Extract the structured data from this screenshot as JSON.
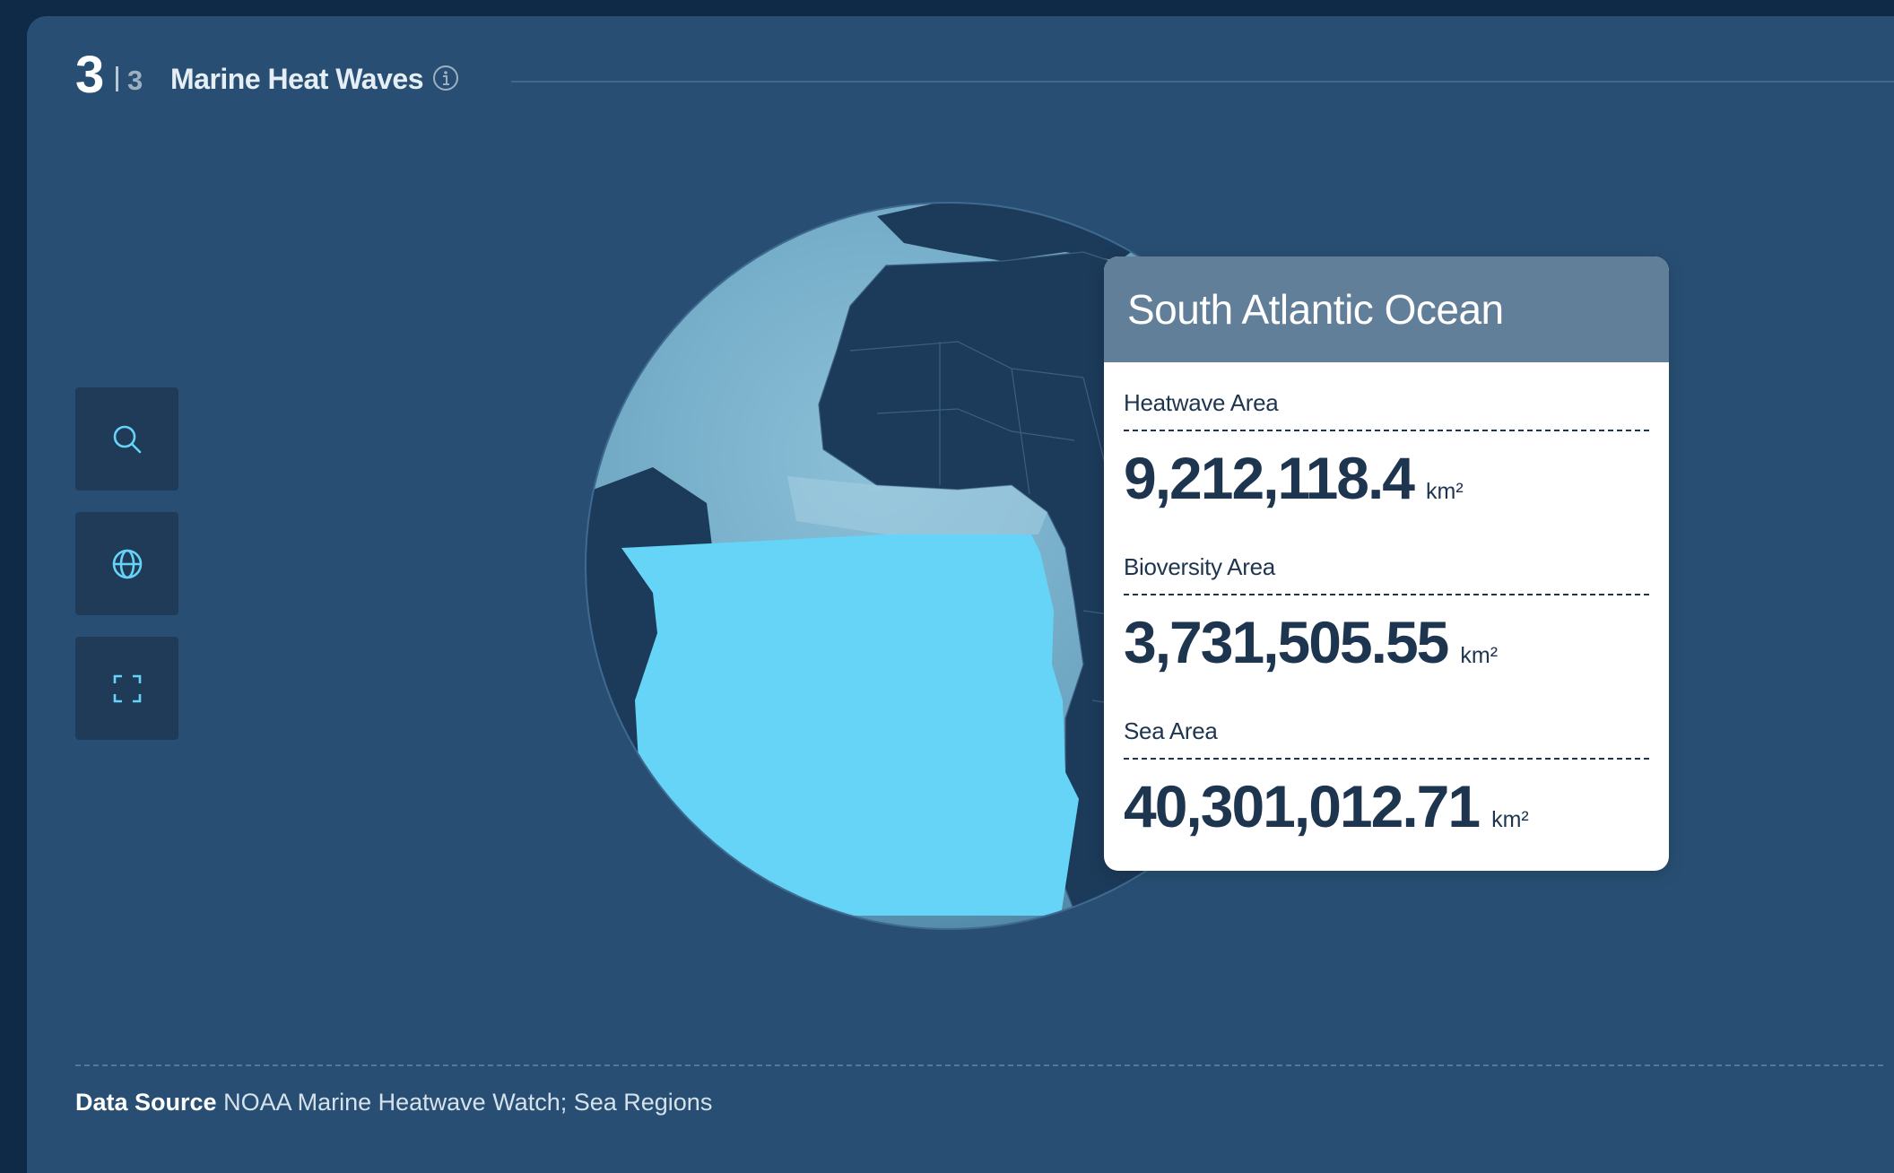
{
  "header": {
    "step_current": "3",
    "step_total": "3",
    "title": "Marine Heat Waves",
    "info_icon": "info-icon"
  },
  "toolbar": {
    "buttons": [
      {
        "name": "search-button",
        "icon": "search-icon"
      },
      {
        "name": "globe-button",
        "icon": "globe-icon"
      },
      {
        "name": "fullscreen-button",
        "icon": "fullscreen-icon"
      }
    ]
  },
  "map": {
    "highlighted_region": "South Atlantic Ocean",
    "colors": {
      "ocean": "#6fa9c6",
      "land": "#1c3b5a",
      "highlight": "#66d4f7"
    }
  },
  "tooltip": {
    "title": "South Atlantic Ocean",
    "metrics": [
      {
        "label": "Heatwave Area",
        "value": "9,212,118.4",
        "unit": "km²"
      },
      {
        "label": "Bioversity Area",
        "value": "3,731,505.55",
        "unit": "km²"
      },
      {
        "label": "Sea Area",
        "value": "40,301,012.71",
        "unit": "km²"
      }
    ]
  },
  "footer": {
    "label": "Data Source",
    "text": "NOAA Marine Heatwave Watch; Sea Regions"
  }
}
